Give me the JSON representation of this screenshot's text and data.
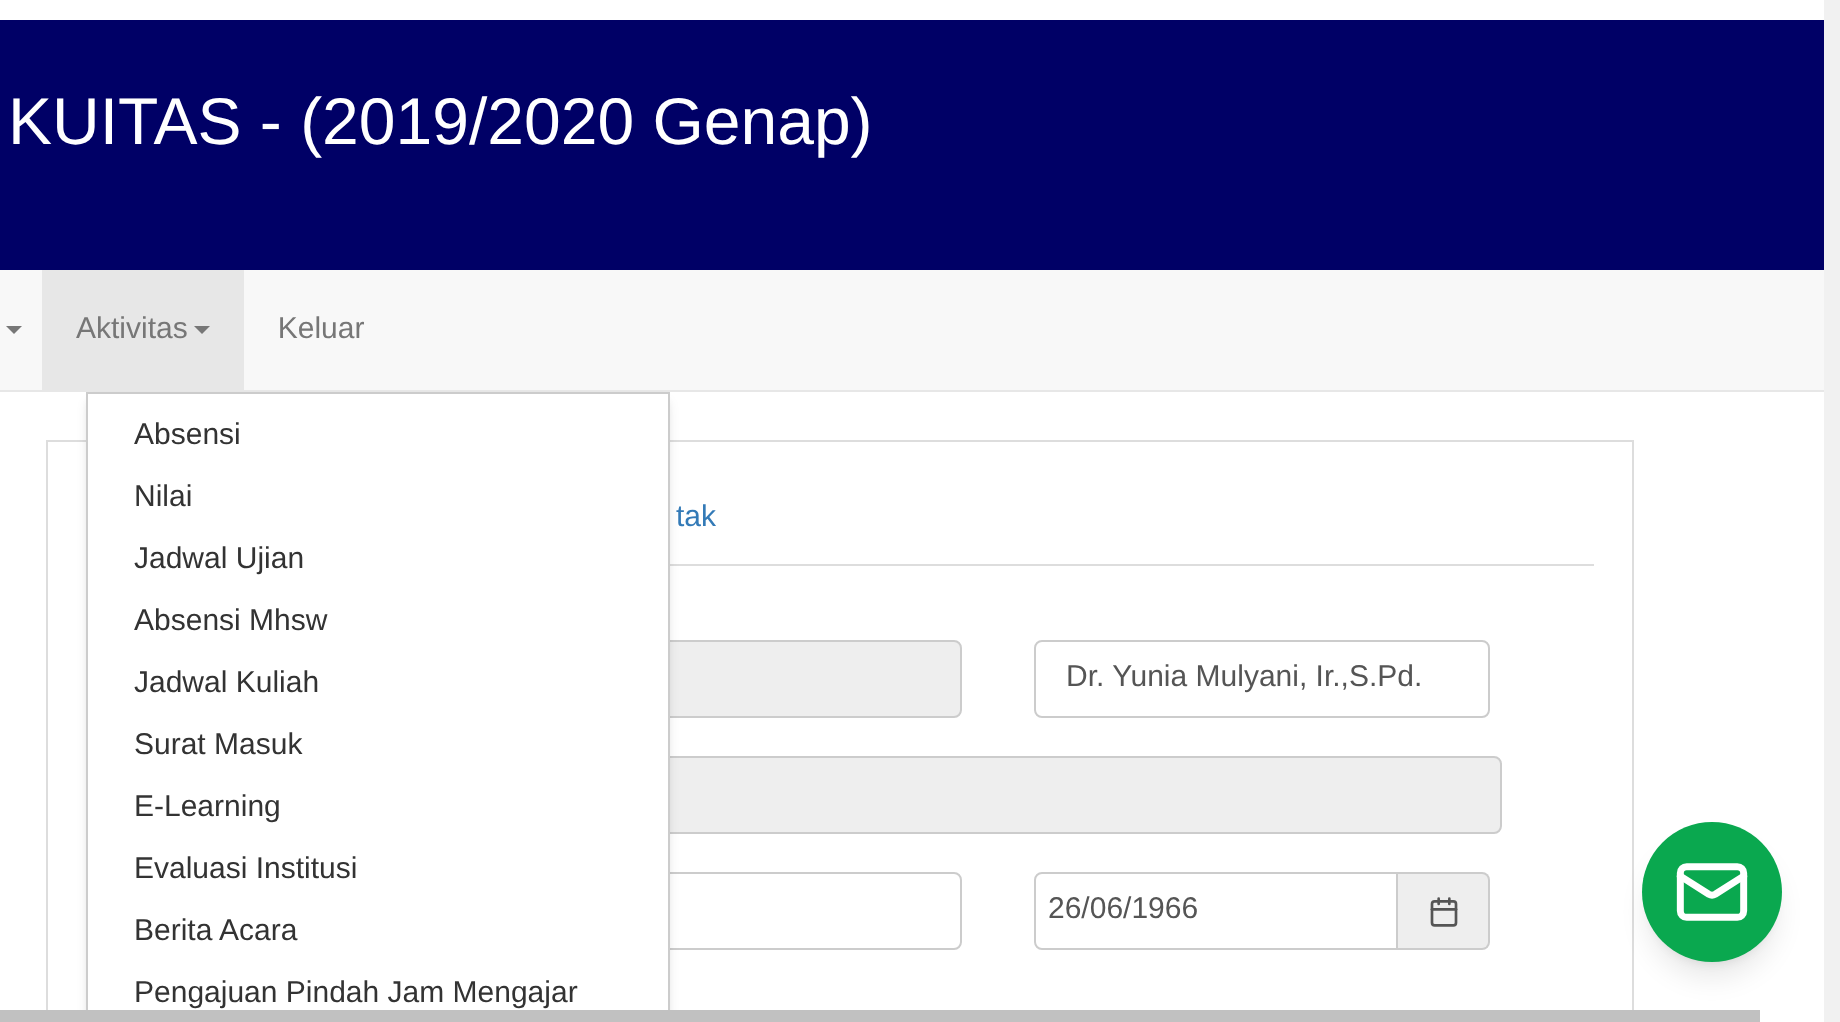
{
  "header": {
    "title": "KUITAS - (2019/2020 Genap)"
  },
  "nav": {
    "items": [
      {
        "caret": true,
        "selected": false
      },
      {
        "label": "Aktivitas",
        "caret": true,
        "selected": true
      },
      {
        "label": "Keluar",
        "caret": false,
        "selected": false
      }
    ]
  },
  "dropdown": {
    "items": [
      "Absensi",
      "Nilai",
      "Jadwal Ujian",
      "Absensi Mhsw",
      "Jadwal Kuliah",
      "Surat Masuk",
      "E-Learning",
      "Evaluasi Institusi",
      "Berita Acara",
      "Pengajuan Pindah Jam Mengajar"
    ]
  },
  "card": {
    "tab_link": "tak",
    "rows": [
      [
        {
          "kind": "text",
          "disabled": true
        },
        {
          "kind": "text",
          "disabled": false,
          "value": "Dr. Yunia Mulyani, Ir.,S.Pd."
        }
      ],
      [
        {
          "kind": "text",
          "disabled": true
        }
      ],
      [
        {
          "kind": "text",
          "disabled": false
        },
        {
          "kind": "date",
          "disabled": false,
          "value": "26/06/1966"
        }
      ]
    ]
  }
}
